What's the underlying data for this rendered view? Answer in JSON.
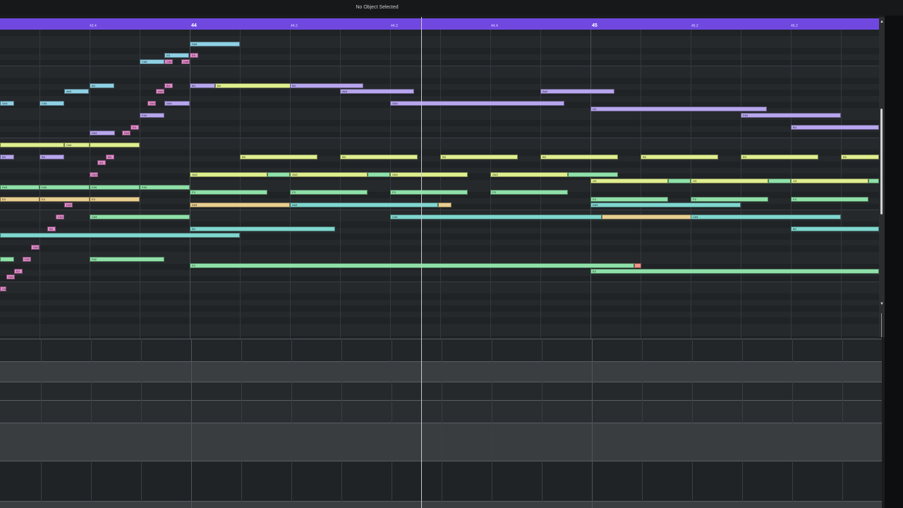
{
  "status_text": "No Object Selected",
  "ruler": {
    "bar_labels": [
      "44",
      "45"
    ],
    "beat_labels": [
      "43.4",
      "44.2",
      "44.3",
      "44.4",
      "45.2"
    ],
    "extra_beat_label": "45.2"
  },
  "notes": [
    {
      "label": "D#5",
      "color": "#8fd0e4"
    },
    {
      "label": "E5",
      "color": "#8fd0e4"
    },
    {
      "label": "C#5",
      "color": "#8fd0e4"
    },
    {
      "label": "E5",
      "color": "#e58ccc"
    },
    {
      "label": "D#5",
      "color": "#e58ccc"
    },
    {
      "label": "C#5",
      "color": "#e58ccc"
    },
    {
      "label": "B4",
      "color": "#8fd0e4"
    },
    {
      "label": "A#4",
      "color": "#8fd0e4"
    },
    {
      "label": "B4",
      "color": "#e58ccc"
    },
    {
      "label": "A#4",
      "color": "#e58ccc"
    },
    {
      "label": "B4",
      "color": "#b7a6ee"
    },
    {
      "label": "B4",
      "color": "#dfee8f"
    },
    {
      "label": "B4",
      "color": "#b7a6ee"
    },
    {
      "label": "A#4",
      "color": "#b7a6ee"
    },
    {
      "label": "A#4",
      "color": "#b7a6ee"
    },
    {
      "label": "G#4",
      "color": "#8fd0e4"
    },
    {
      "label": "C#4",
      "color": "#8fd0e4"
    },
    {
      "label": "G#4",
      "color": "#e58ccc"
    },
    {
      "label": "G#4",
      "color": "#b7a6ee"
    },
    {
      "label": "G#4",
      "color": "#b7a6ee"
    },
    {
      "label": "G4",
      "color": "#b7a6ee"
    },
    {
      "label": "F#4",
      "color": "#b7a6ee"
    },
    {
      "label": "F#4",
      "color": "#b7a6ee"
    },
    {
      "label": "B4",
      "color": "#b7a6ee"
    },
    {
      "label": "E4",
      "color": "#e58ccc"
    },
    {
      "label": "D#4",
      "color": "#e58ccc"
    },
    {
      "label": "D#4",
      "color": "#b7a6ee"
    },
    {
      "label": "C#4",
      "color": "#dfee8f"
    },
    {
      "label": "",
      "color": "#dfee8f"
    },
    {
      "label": "",
      "color": "#dfee8f"
    },
    {
      "label": "B3",
      "color": "#b7a6ee"
    },
    {
      "label": "B3",
      "color": "#b7a6ee"
    },
    {
      "label": "B3",
      "color": "#e58ccc"
    },
    {
      "label": "A3",
      "color": "#e58ccc"
    },
    {
      "label": "B3",
      "color": "#dfee8f"
    },
    {
      "label": "B3",
      "color": "#dfee8f"
    },
    {
      "label": "B3",
      "color": "#dfee8f"
    },
    {
      "label": "B3",
      "color": "#dfee8f"
    },
    {
      "label": "B3",
      "color": "#dfee8f"
    },
    {
      "label": "B3",
      "color": "#dfee8f"
    },
    {
      "label": "B3",
      "color": "#dfee8f"
    },
    {
      "label": "G#3",
      "color": "#e58ccc"
    },
    {
      "label": "G#3",
      "color": "#dfee8f"
    },
    {
      "label": "",
      "color": "#8fe0a8"
    },
    {
      "label": "G#3",
      "color": "#dfee8f"
    },
    {
      "label": "",
      "color": "#8fe0a8"
    },
    {
      "label": "G#3",
      "color": "#dfee8f"
    },
    {
      "label": "G#3",
      "color": "#dfee8f"
    },
    {
      "label": "",
      "color": "#8fe0a8"
    },
    {
      "label": "G3",
      "color": "#dfee8f"
    },
    {
      "label": "",
      "color": "#8fe0a8"
    },
    {
      "label": "G3",
      "color": "#dfee8f"
    },
    {
      "label": "",
      "color": "#8fe0a8"
    },
    {
      "label": "G3",
      "color": "#dfee8f"
    },
    {
      "label": "",
      "color": "#8fe0a8"
    },
    {
      "label": "F#3",
      "color": "#8fe0a8"
    },
    {
      "label": "F#3",
      "color": "#8fe0a8"
    },
    {
      "label": "F#3",
      "color": "#8fe0a8"
    },
    {
      "label": "F#3",
      "color": "#8fe0a8"
    },
    {
      "label": "F3",
      "color": "#8fe0a8"
    },
    {
      "label": "F3",
      "color": "#8fe0a8"
    },
    {
      "label": "F3",
      "color": "#8fe0a8"
    },
    {
      "label": "F3",
      "color": "#8fe0a8"
    },
    {
      "label": "F3",
      "color": "#8fe0a8"
    },
    {
      "label": "F3",
      "color": "#8fe0a8"
    },
    {
      "label": "F3",
      "color": "#8fe0a8"
    },
    {
      "label": "E3",
      "color": "#e8cf90"
    },
    {
      "label": "E3",
      "color": "#e8cf90"
    },
    {
      "label": "E3",
      "color": "#e8cf90"
    },
    {
      "label": "D#3",
      "color": "#e58ccc"
    },
    {
      "label": "D#3",
      "color": "#e8cf90"
    },
    {
      "label": "D#3",
      "color": "#7fd6ce"
    },
    {
      "label": "",
      "color": "#e8cf90"
    },
    {
      "label": "D#3",
      "color": "#7fd6ce"
    },
    {
      "label": "C#3",
      "color": "#e58ccc"
    },
    {
      "label": "C#3",
      "color": "#8fe0a8"
    },
    {
      "label": "C#3",
      "color": "#7fd6ce"
    },
    {
      "label": "",
      "color": "#e8cf90"
    },
    {
      "label": "C#3",
      "color": "#7fd6ce"
    },
    {
      "label": "B2",
      "color": "#e58ccc"
    },
    {
      "label": "B2",
      "color": "#7fd6ce"
    },
    {
      "label": "B2",
      "color": "#7fd6ce"
    },
    {
      "label": "",
      "color": "#7fd6ce"
    },
    {
      "label": "G#2",
      "color": "#e58ccc"
    },
    {
      "label": "",
      "color": "#8fe0a8"
    },
    {
      "label": "F#2",
      "color": "#e58ccc"
    },
    {
      "label": "F#2",
      "color": "#8fe0a8"
    },
    {
      "label": "F2",
      "color": "#8fe0a8"
    },
    {
      "label": "",
      "color": "#f0948a"
    },
    {
      "label": "E2",
      "color": "#8fe0a8"
    },
    {
      "label": "E2",
      "color": "#e58ccc"
    },
    {
      "label": "D#2",
      "color": "#e58ccc"
    },
    {
      "label": "C#2",
      "color": "#e58ccc"
    }
  ]
}
